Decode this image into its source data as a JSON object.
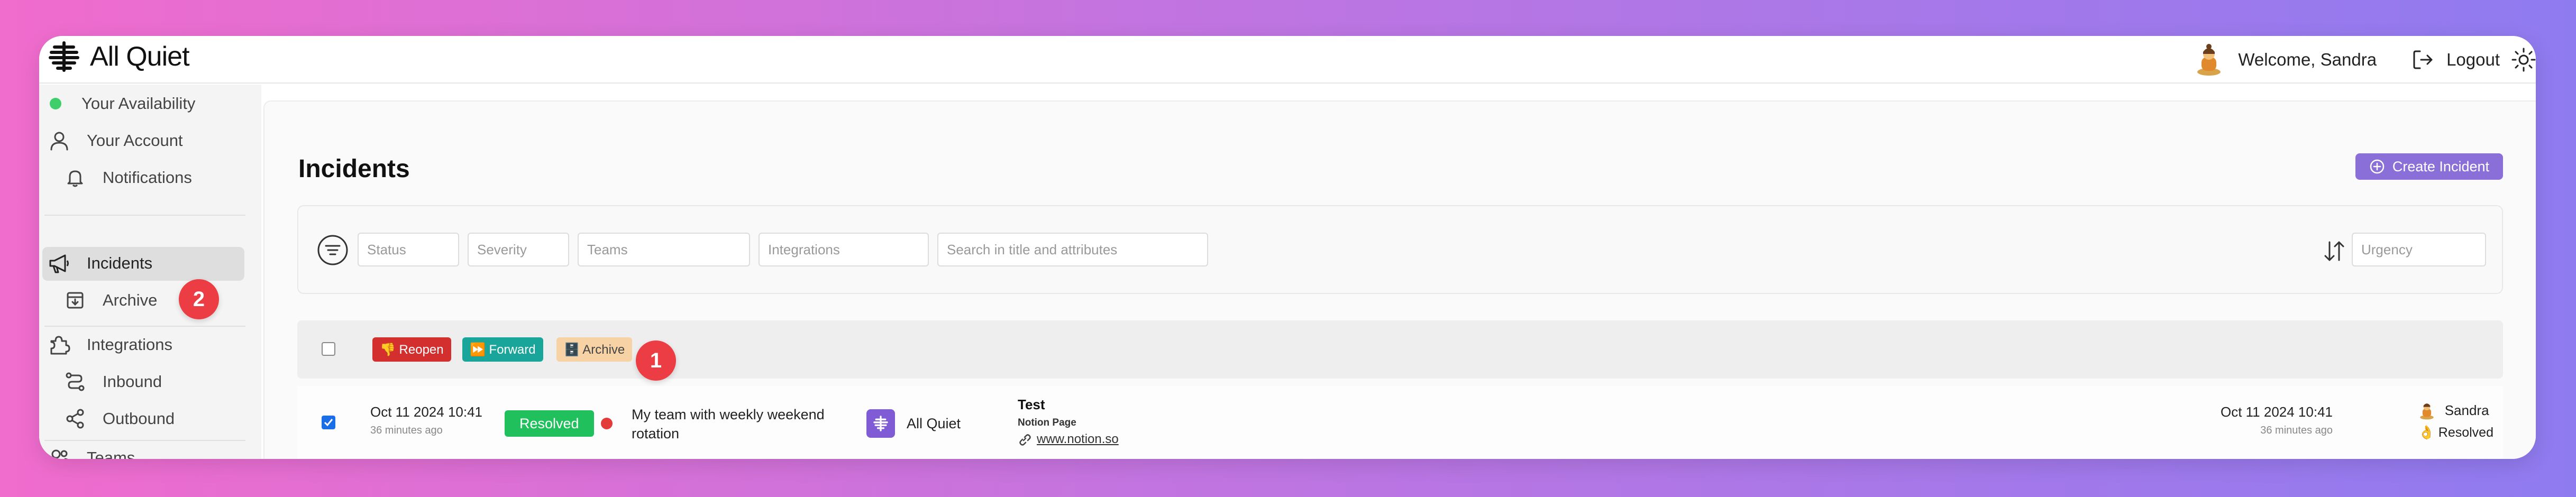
{
  "app": {
    "name": "All Quiet"
  },
  "header": {
    "welcome": "Welcome, Sandra",
    "logout": "Logout"
  },
  "sidebar": {
    "items": [
      {
        "label": "Your Availability"
      },
      {
        "label": "Your Account"
      },
      {
        "label": "Notifications"
      },
      {
        "label": "Incidents"
      },
      {
        "label": "Archive"
      },
      {
        "label": "Integrations"
      },
      {
        "label": "Inbound"
      },
      {
        "label": "Outbound"
      },
      {
        "label": "Teams"
      }
    ],
    "active": "Incidents",
    "availability_color": "#3fcf6a"
  },
  "main": {
    "title": "Incidents",
    "create_button": "Create Incident",
    "filters": {
      "status": "Status",
      "severity": "Severity",
      "teams": "Teams",
      "integrations": "Integrations",
      "search": "Search in title and attributes",
      "urgency": "Urgency"
    },
    "bulk_actions": {
      "reopen": "👎 Reopen",
      "forward": "⏩ Forward",
      "archive": "🗄️ Archive"
    },
    "badges": {
      "one": "1",
      "two": "2"
    },
    "incidents": [
      {
        "checked": true,
        "created": "Oct 11 2024 10:41",
        "created_ago": "36 minutes ago",
        "status": "Resolved",
        "title": "My team with weekly weekend rotation",
        "integration": "All Quiet",
        "attr_title": "Test",
        "attr_key": "Notion Page",
        "attr_link": "www.notion.so",
        "updated": "Oct 11 2024 10:41",
        "updated_ago": "36 minutes ago",
        "assignee": "Sandra",
        "assignee_status": "👌 Resolved"
      }
    ]
  },
  "colors": {
    "accent": "#8b6fd8",
    "resolved": "#20c05c",
    "badge": "#ec3d45",
    "reopen": "#d32f2f",
    "forward": "#1aa59a",
    "archive": "#f6d2a4"
  }
}
